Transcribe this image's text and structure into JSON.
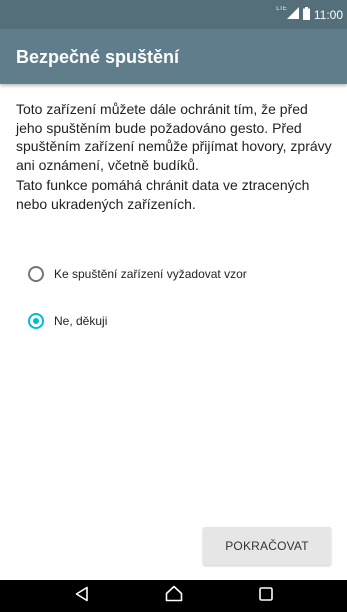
{
  "status_bar": {
    "network": "LTE",
    "time": "11:00"
  },
  "header": {
    "title": "Bezpečné spuštění"
  },
  "body": {
    "paragraph1": "Toto zařízení můžete dále ochránit tím, že před jeho spuštěním bude požadováno gesto. Před spuštěním zařízení nemůže přijímat hovory, zprávy ani oznámení, včetně budíků.",
    "paragraph2": "Tato funkce pomáhá chránit data ve ztracených nebo ukradených zařízeních."
  },
  "options": [
    {
      "label": "Ke spuštění zařízení vyžadovat vzor",
      "selected": false
    },
    {
      "label": "Ne, děkuji",
      "selected": true
    }
  ],
  "footer": {
    "continue_label": "POKRAČOVAT"
  },
  "nav": {
    "back_icon": "triangle-left",
    "home_icon": "house-outline",
    "recent_icon": "square-outline"
  },
  "colors": {
    "status_bar": "#546e7a",
    "app_bar": "#607d8b",
    "accent": "#00bcd4"
  }
}
